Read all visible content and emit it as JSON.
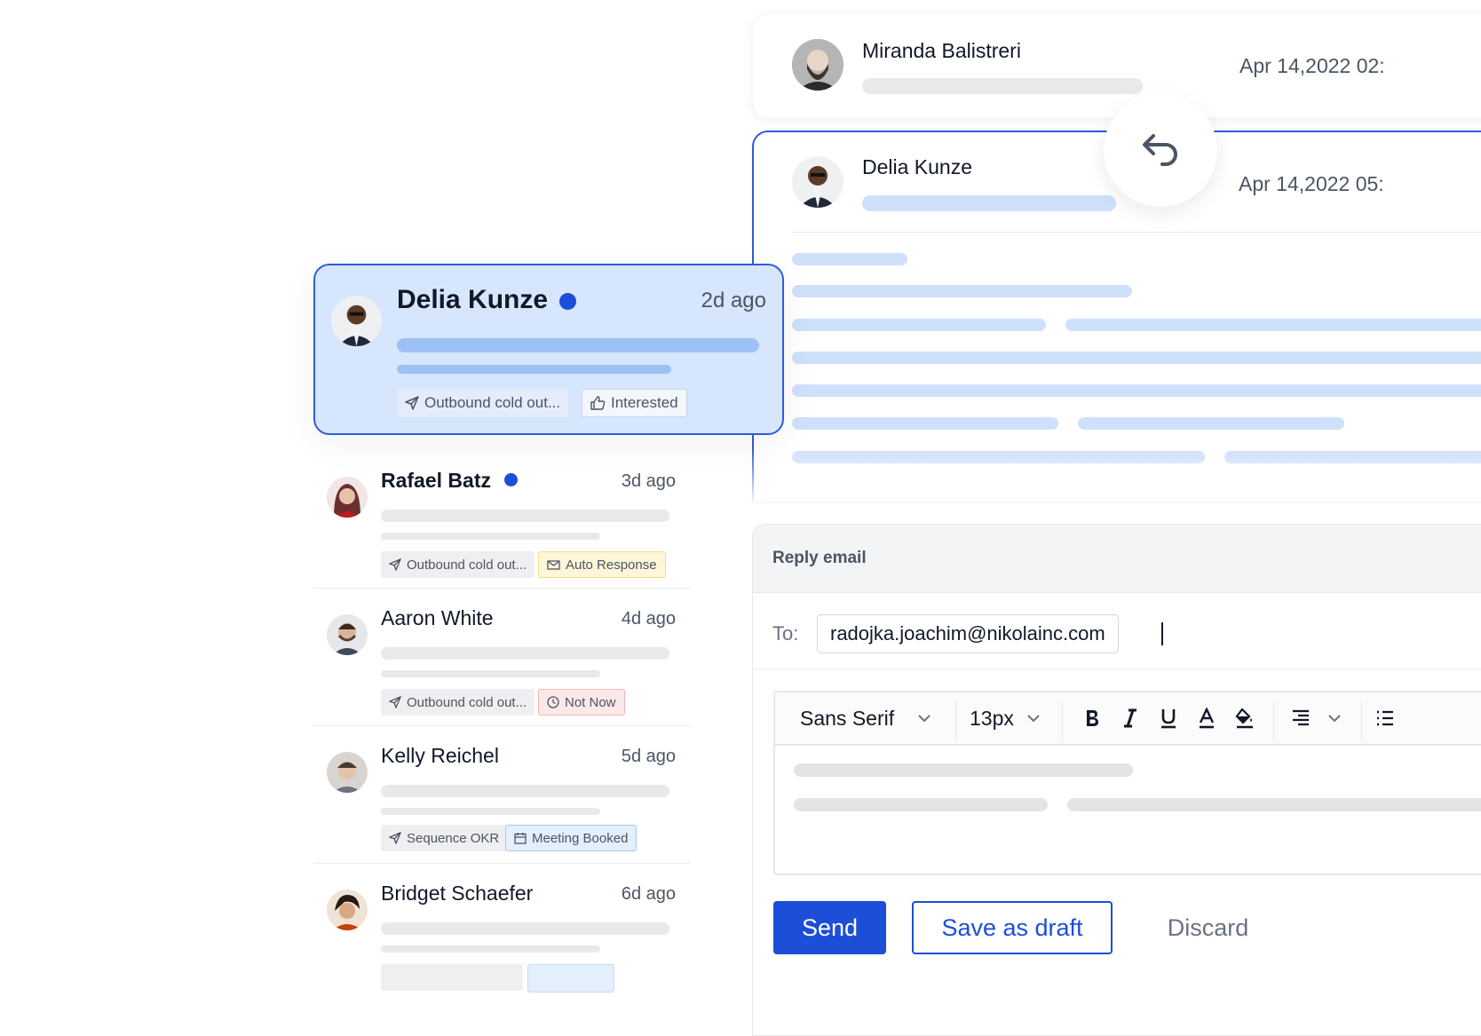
{
  "thread": {
    "messages": [
      {
        "sender": "Miranda Balistreri",
        "date": "Apr 14,2022 02:"
      },
      {
        "sender": "Delia Kunze",
        "date": "Apr 14,2022 05:"
      }
    ],
    "reply_icon": "reply-arrow-icon"
  },
  "inbox": {
    "items": [
      {
        "name": "Delia Kunze",
        "time": "2d ago",
        "unread": true,
        "selected": true,
        "tags": [
          {
            "label": "Outbound cold out...",
            "icon": "send-icon"
          },
          {
            "label": "Interested",
            "icon": "thumbs-up-icon"
          }
        ]
      },
      {
        "name": "Rafael Batz",
        "time": "3d ago",
        "unread": true,
        "tags": [
          {
            "label": "Outbound cold out...",
            "icon": "send-icon"
          },
          {
            "label": "Auto Response",
            "icon": "envelope-icon",
            "color": "#fdf6d8"
          }
        ]
      },
      {
        "name": "Aaron White",
        "time": "4d ago",
        "unread": false,
        "tags": [
          {
            "label": "Outbound cold out...",
            "icon": "send-icon"
          },
          {
            "label": "Not Now",
            "icon": "clock-icon",
            "color": "#fde8e8"
          }
        ]
      },
      {
        "name": "Kelly Reichel",
        "time": "5d ago",
        "unread": false,
        "tags": [
          {
            "label": "Sequence OKR",
            "icon": "send-icon"
          },
          {
            "label": "Meeting Booked",
            "icon": "calendar-icon",
            "color": "#e4effc"
          }
        ]
      },
      {
        "name": "Bridget Schaefer",
        "time": "6d ago",
        "unread": false
      }
    ]
  },
  "reply": {
    "header": "Reply email",
    "to_label": "To:",
    "to_value": "radojka.joachim@nikolainc.com",
    "toolbar": {
      "font": "Sans Serif",
      "size": "13px",
      "icons": [
        "bold-icon",
        "italic-icon",
        "underline-icon",
        "text-color-icon",
        "fill-color-icon",
        "align-icon",
        "chevron-down-icon",
        "list-icon"
      ]
    },
    "buttons": {
      "send": "Send",
      "draft": "Save as draft",
      "discard": "Discard"
    }
  },
  "colors": {
    "accent": "#1d4ed8",
    "selected_bg": "#d6e6fc",
    "skeleton_blue": "#cfe0fb",
    "skeleton_gray": "#e9e9eb"
  }
}
